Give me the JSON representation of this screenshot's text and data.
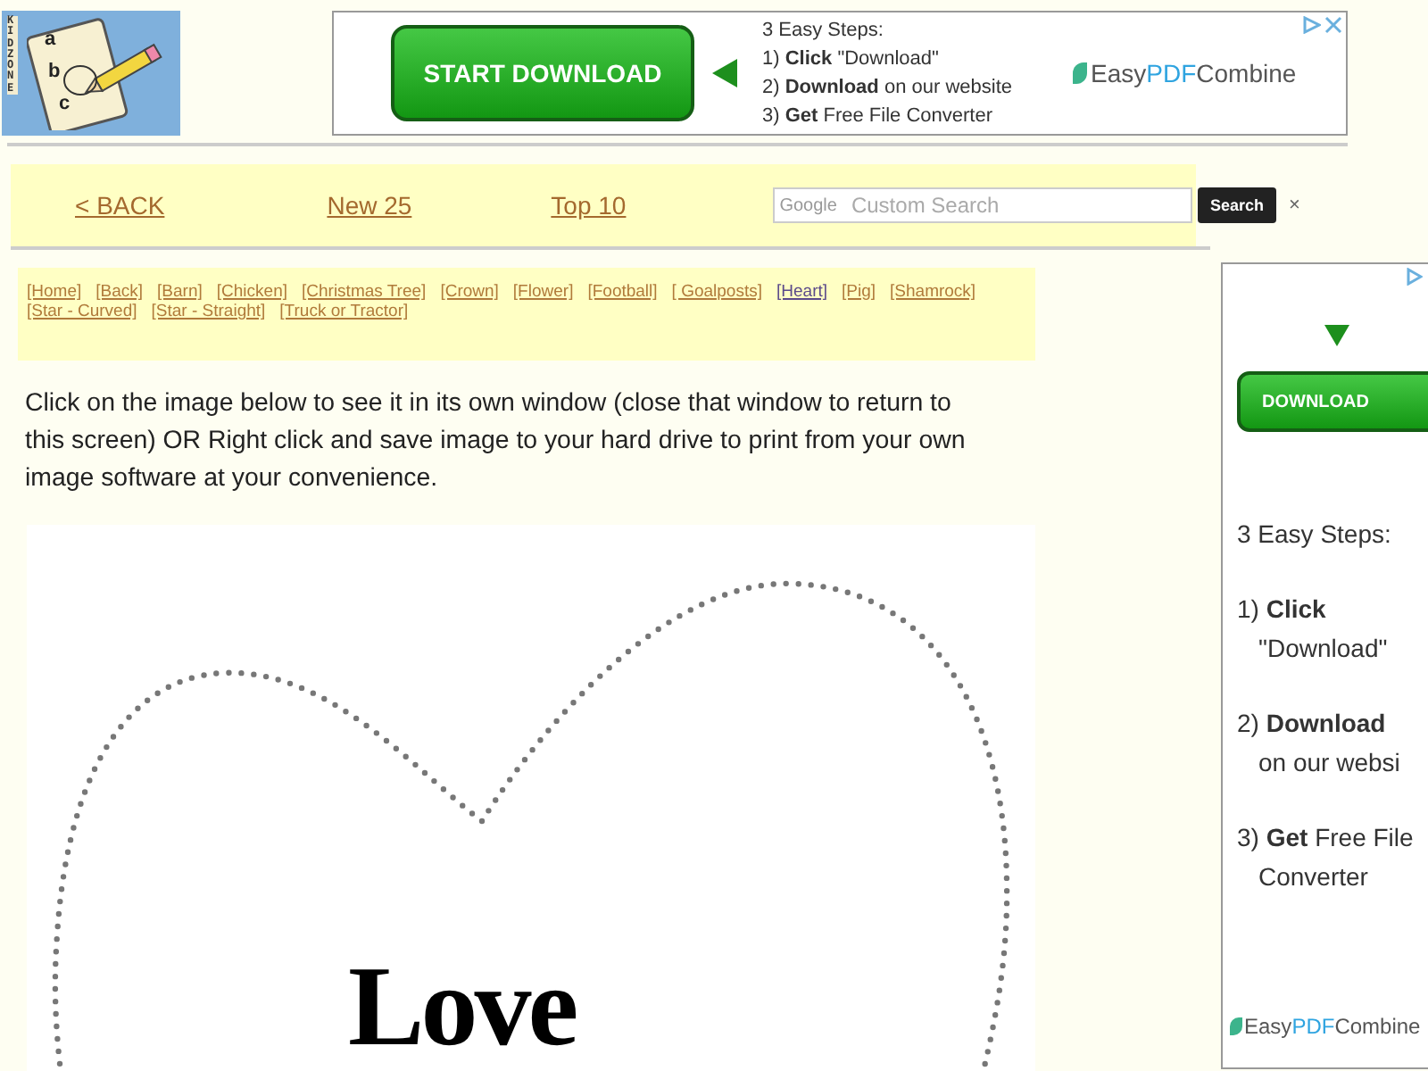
{
  "logo": {
    "side_text": "KIDZONE",
    "letters": [
      "a",
      "b",
      "c"
    ]
  },
  "top_ad": {
    "button": "START DOWNLOAD",
    "steps_title": "3 Easy Steps:",
    "steps": [
      "1) **Click** \"Download\"",
      "2) **Download** on our website",
      "3) **Get** Free File Converter"
    ],
    "brand_parts": [
      "Easy",
      "PDF",
      "Combine"
    ]
  },
  "nav": {
    "links": [
      "< BACK",
      "New 25",
      "Top 10"
    ],
    "search": {
      "google_label": "Google",
      "placeholder": "Custom Search",
      "button": "Search",
      "clear": "×"
    }
  },
  "category_links": [
    {
      "label": "[Home]",
      "visited": false
    },
    {
      "label": "[Back]",
      "visited": false
    },
    {
      "label": "[Barn]",
      "visited": false
    },
    {
      "label": "[Chicken]",
      "visited": false
    },
    {
      "label": "[Christmas Tree]",
      "visited": false
    },
    {
      "label": "[Crown]",
      "visited": false
    },
    {
      "label": "[Flower]",
      "visited": false
    },
    {
      "label": "[Football]",
      "visited": false
    },
    {
      "label": "[ Goalposts]",
      "visited": false
    },
    {
      "label": "[Heart]",
      "visited": true
    },
    {
      "label": "[Pig]",
      "visited": false
    },
    {
      "label": "[Shamrock]",
      "visited": false
    },
    {
      "label": "[Star - Curved]",
      "visited": false
    },
    {
      "label": "[Star - Straight]",
      "visited": false
    },
    {
      "label": "[Truck or Tractor]",
      "visited": false
    }
  ],
  "instructions": "Click on the image below to see it in its own window (close that window to return to this screen) OR Right click and save image to your hard drive to print from your own image software at your convenience.",
  "coloring_page": {
    "title": "Love"
  },
  "side_ad": {
    "button": "DOWNLOAD",
    "steps_title": "3 Easy Steps:",
    "steps": [
      {
        "lead": "1) **Click**",
        "rest": "\"Download\""
      },
      {
        "lead": "2) **Download**",
        "rest": "on our websi"
      },
      {
        "lead": "3) **Get** Free File",
        "rest": "Converter"
      }
    ],
    "brand_parts": [
      "Easy",
      "PDF",
      "Combine"
    ]
  }
}
